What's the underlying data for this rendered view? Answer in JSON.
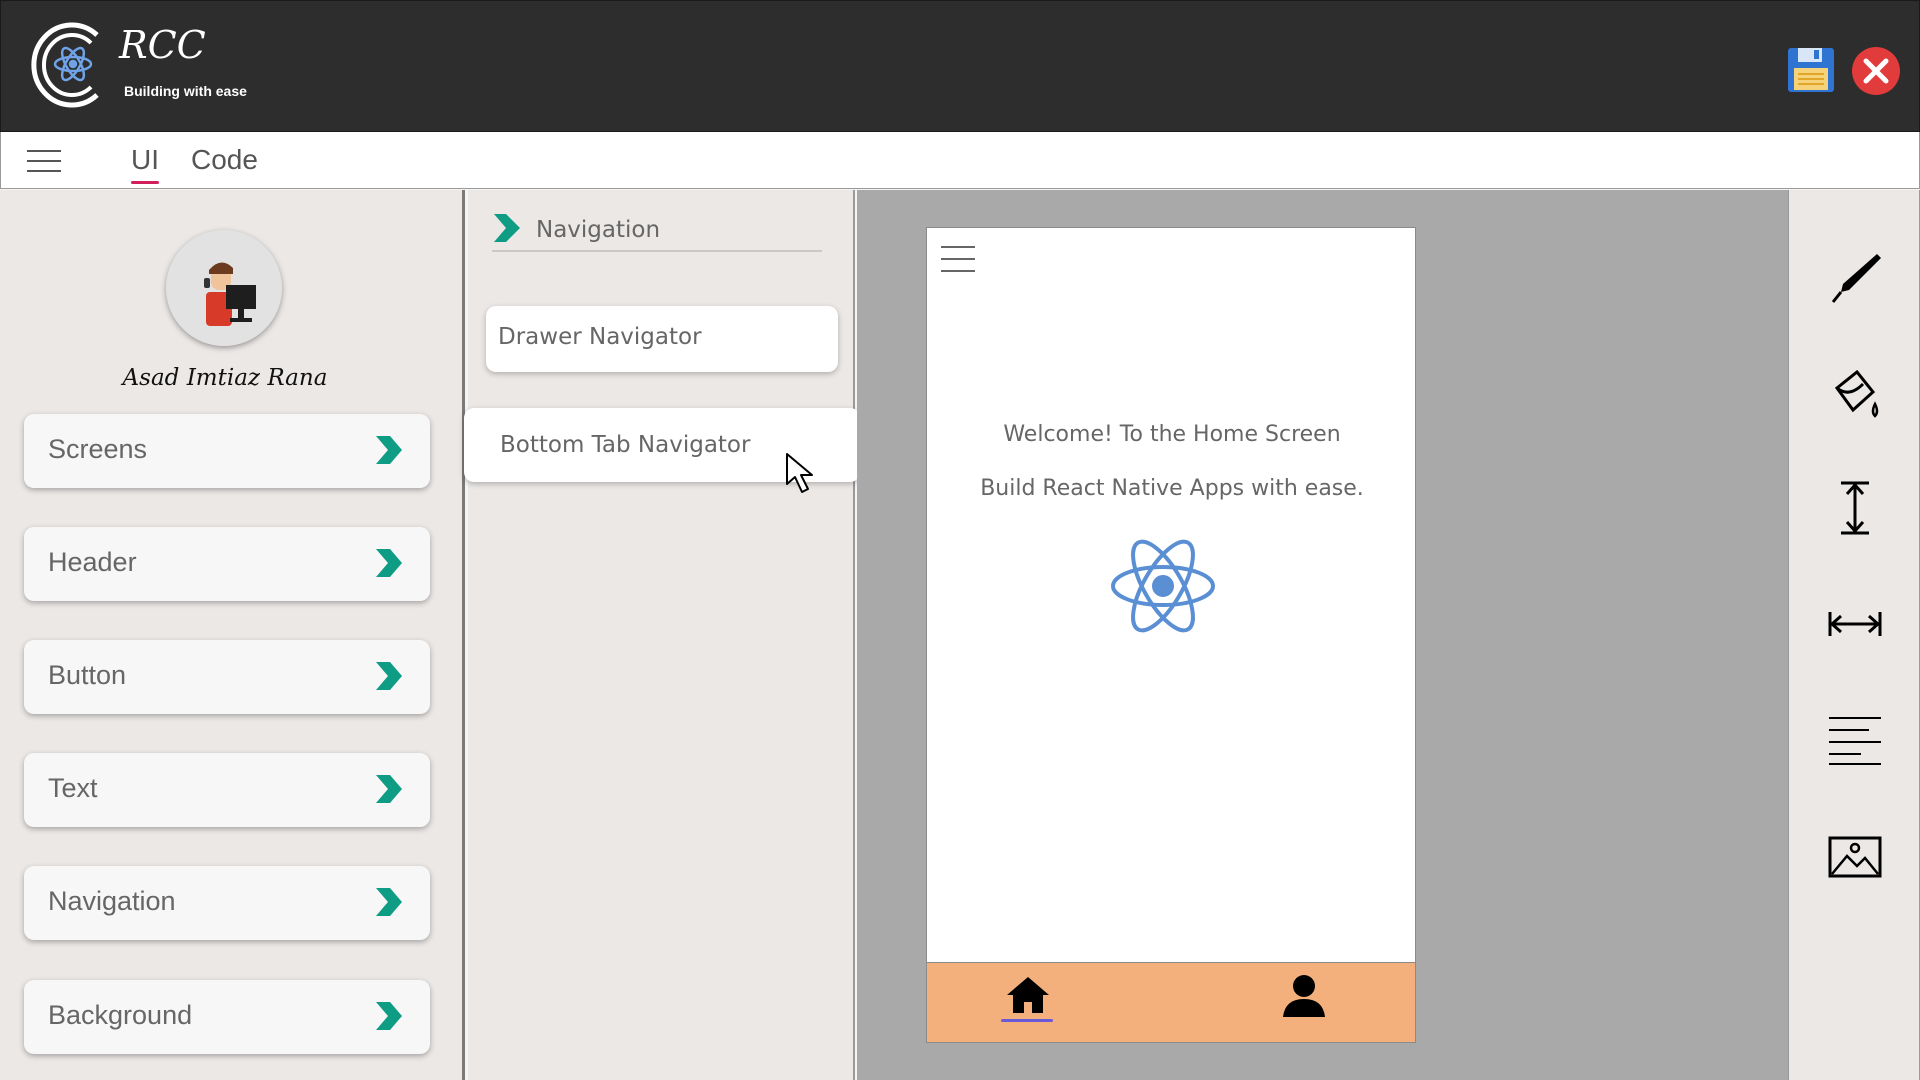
{
  "app": {
    "title": "RCC",
    "tagline": "Building with ease",
    "icons": [
      "rcc-logo-icon",
      "save-icon",
      "close-icon"
    ],
    "colors": {
      "titlebar": "#2d2d2d",
      "accent": "#d21f5a",
      "chevron": "#0e9c85",
      "tabnav": "#f3b07c",
      "react": "#5a8fd4"
    }
  },
  "tabs": [
    {
      "label": "UI",
      "active": true
    },
    {
      "label": "Code",
      "active": false
    }
  ],
  "sidebar": {
    "user_name": "Asad Imtiaz Rana",
    "items": [
      {
        "label": "Screens"
      },
      {
        "label": "Header"
      },
      {
        "label": "Button"
      },
      {
        "label": "Text"
      },
      {
        "label": "Navigation"
      },
      {
        "label": "Background"
      }
    ]
  },
  "subpanel": {
    "title": "Navigation",
    "items": [
      {
        "label": "Drawer Navigator"
      },
      {
        "label": "Bottom Tab Navigator"
      }
    ]
  },
  "preview": {
    "welcome": "Welcome! To the Home Screen",
    "subtitle": "Build React Native Apps with ease.",
    "tab_icons": [
      "home-icon",
      "person-icon"
    ]
  },
  "toolbar": {
    "icons": [
      "pen-icon",
      "paint-bucket-icon",
      "vertical-resize-icon",
      "horizontal-resize-icon",
      "text-align-icon",
      "image-icon"
    ]
  }
}
